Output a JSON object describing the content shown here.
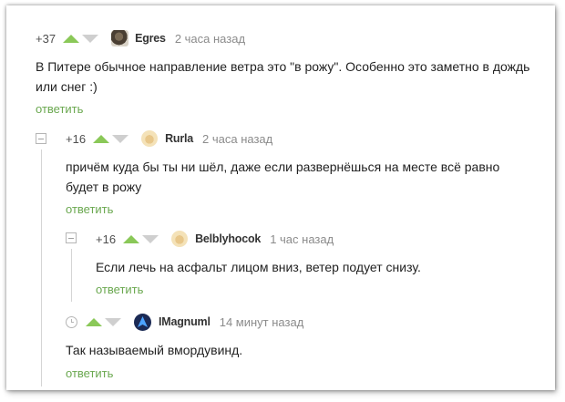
{
  "comments": [
    {
      "rating": "+37",
      "author": "Egres",
      "time": "2 часа назад",
      "text": "В Питере обычное направление ветра это \"в рожу\". Особенно это заметно в дождь или снег :)",
      "reply": "ответить",
      "avatar_icon": "dog-avatar-icon"
    },
    {
      "rating": "+16",
      "author": "Rurla",
      "time": "2 часа назад",
      "text": "причём куда бы ты ни шёл, даже если развернёшься на месте всё равно будет в рожу",
      "reply": "ответить",
      "avatar_icon": "default-avatar-icon"
    },
    {
      "rating": "+16",
      "author": "Belblyhocok",
      "time": "1 час назад",
      "text": "Если лечь на асфальт лицом вниз, ветер подует снизу.",
      "reply": "ответить",
      "avatar_icon": "default-avatar-icon"
    },
    {
      "rating": "",
      "author": "IMagnuml",
      "time": "14 минут назад",
      "text": "Так называемый вмордувинд.",
      "reply": "ответить",
      "avatar_icon": "blue-logo-avatar-icon"
    }
  ],
  "colors": {
    "upvote": "#8ac858",
    "downvote": "#cfcfcf",
    "reply_link": "#6aa84f",
    "time": "#8b8b8b"
  }
}
